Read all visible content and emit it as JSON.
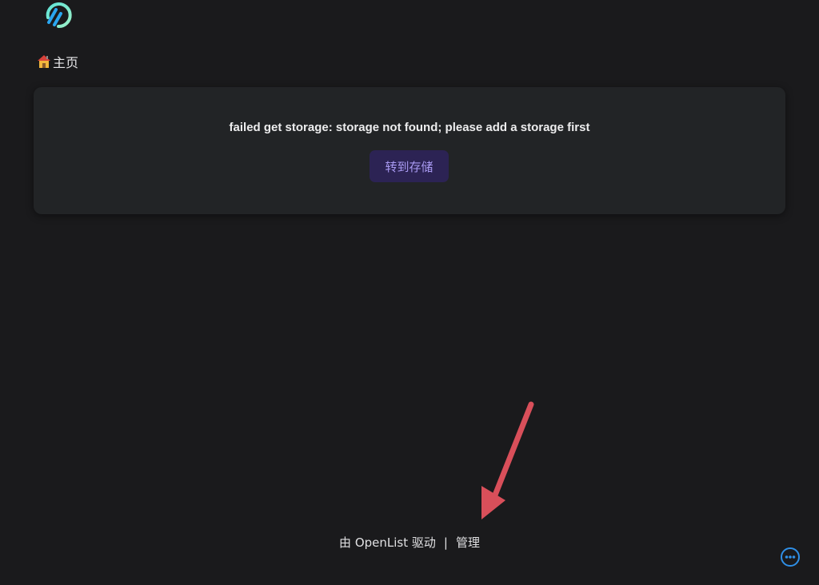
{
  "header": {
    "logo_icon": "openlist-logo-icon"
  },
  "breadcrumb": {
    "home_icon": "house-emoji-icon",
    "home_label": "主页"
  },
  "error_card": {
    "message": "failed get storage: storage not found; please add a storage first",
    "button_label": "转到存储"
  },
  "footer": {
    "powered_by": "由 OpenList 驱动",
    "separator": "|",
    "manage_label": "管理"
  },
  "annotation": {
    "arrow_icon": "red-arrow-icon",
    "arrow_color": "#d94f5a"
  },
  "floating": {
    "more_icon": "more-horizontal-icon"
  },
  "colors": {
    "background": "#1a1a1c",
    "card": "#222426",
    "button_bg": "#2c2354",
    "button_text": "#a99af2",
    "accent_blue": "#2f8fe6",
    "logo_teal": "#6ee7d0"
  }
}
